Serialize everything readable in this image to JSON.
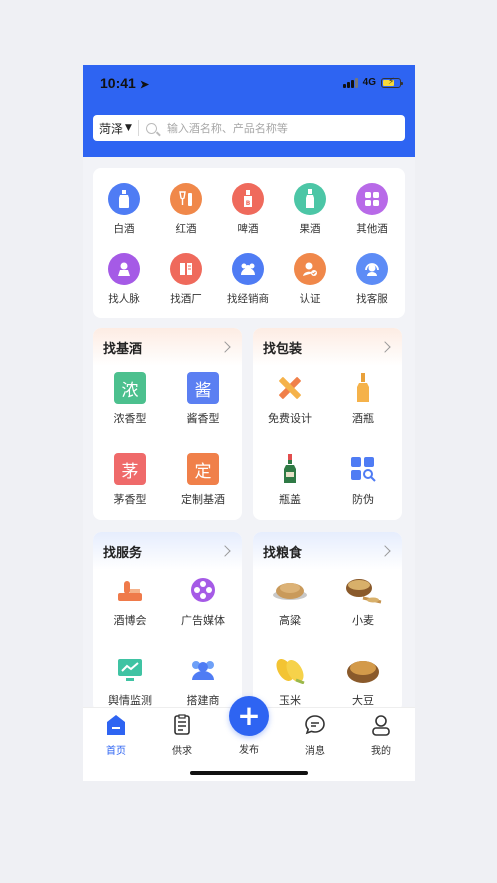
{
  "status": {
    "time": "10:41",
    "network": "4G"
  },
  "search": {
    "city": "菏泽",
    "placeholder": "输入酒名称、产品名称等"
  },
  "categories": [
    {
      "label": "白酒",
      "icon": "bottle-icon",
      "color": "#4f7cf4"
    },
    {
      "label": "红酒",
      "icon": "wine-glass-icon",
      "color": "#f0884a"
    },
    {
      "label": "啤酒",
      "icon": "beer-icon",
      "color": "#ef6a5c"
    },
    {
      "label": "果酒",
      "icon": "fruit-wine-icon",
      "color": "#4cc6a6"
    },
    {
      "label": "其他酒",
      "icon": "grid-icon",
      "color": "#b86ae8"
    },
    {
      "label": "找人脉",
      "icon": "person-icon",
      "color": "#a55ae6"
    },
    {
      "label": "找酒厂",
      "icon": "factory-icon",
      "color": "#ef6a5c"
    },
    {
      "label": "找经销商",
      "icon": "group-icon",
      "color": "#4f7cf4"
    },
    {
      "label": "认证",
      "icon": "verified-icon",
      "color": "#f0884a"
    },
    {
      "label": "找客服",
      "icon": "headset-icon",
      "color": "#5d8cf6"
    }
  ],
  "sections": {
    "base_liquor": {
      "title": "找基酒",
      "items": [
        {
          "label": "浓香型",
          "glyph": "浓",
          "color": "#4cc08e"
        },
        {
          "label": "酱香型",
          "glyph": "酱",
          "color": "#5b7ff2"
        },
        {
          "label": "茅香型",
          "glyph": "茅",
          "color": "#ef6a6a"
        },
        {
          "label": "定制基酒",
          "glyph": "定",
          "color": "#f0804a"
        }
      ]
    },
    "packaging": {
      "title": "找包装",
      "items": [
        {
          "label": "免费设计",
          "icon": "design-tools-icon"
        },
        {
          "label": "酒瓶",
          "icon": "bottle-icon"
        },
        {
          "label": "瓶盖",
          "icon": "bottle-cap-icon"
        },
        {
          "label": "防伪",
          "icon": "anti-counterfeit-icon"
        }
      ]
    },
    "services": {
      "title": "找服务",
      "items": [
        {
          "label": "酒博会",
          "icon": "expo-icon"
        },
        {
          "label": "广告媒体",
          "icon": "film-reel-icon"
        },
        {
          "label": "舆情监测",
          "icon": "monitor-chart-icon"
        },
        {
          "label": "搭建商",
          "icon": "team-icon"
        }
      ]
    },
    "grain": {
      "title": "找粮食",
      "items": [
        {
          "label": "高粱",
          "icon": "sorghum-icon"
        },
        {
          "label": "小麦",
          "icon": "wheat-icon"
        },
        {
          "label": "玉米",
          "icon": "corn-icon"
        },
        {
          "label": "大豆",
          "icon": "soybean-icon"
        }
      ]
    }
  },
  "tabs": {
    "home": "首页",
    "supply": "供求",
    "publish": "发布",
    "messages": "消息",
    "mine": "我的"
  }
}
